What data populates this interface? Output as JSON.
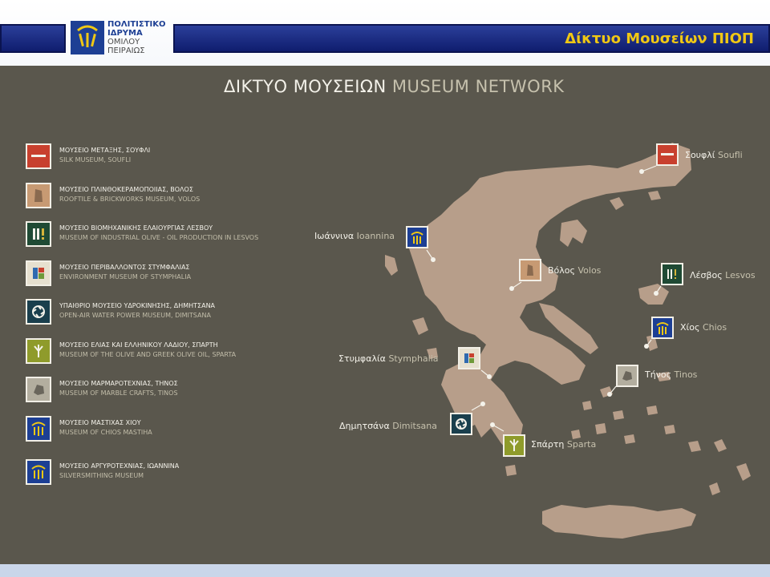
{
  "header": {
    "logo": {
      "line1": "ΠΟΛΙΤΙΣΤΙΚΟ",
      "line2": "ΙΔΡΥΜΑ",
      "line3": "ΟΜΙΛΟΥ",
      "line4": "ΠΕΙΡΑΙΩΣ"
    },
    "title": "Δίκτυο Μουσείων ΠΙΟΠ"
  },
  "panel": {
    "title_gr": "ΔΙΚΤΥΟ ΜΟΥΣΕΙΩΝ",
    "title_en": "MUSEUM NETWORK"
  },
  "legend": [
    {
      "gr": "ΜΟΥΣΕΙΟ ΜΕΤΑΞΗΣ, ΣΟΥΦΛΙ",
      "en": "SILK MUSEUM, SOUFLI",
      "color": "#c8402e",
      "icon": "silk-icon"
    },
    {
      "gr": "ΜΟΥΣΕΙΟ ΠΛΙΝΘΟΚΕΡΑΜΟΠΟΙΙΑΣ, ΒΟΛΟΣ",
      "en": "ROOFTILE & BRICKWORKS MUSEUM, VOLOS",
      "color": "#c79a73",
      "icon": "brick-icon"
    },
    {
      "gr": "ΜΟΥΣΕΙΟ ΒΙΟΜΗΧΑΝΙΚΗΣ ΕΛΑΙΟΥΡΓΙΑΣ ΛΕΣΒΟΥ",
      "en": "MUSEUM OF INDUSTRIAL OLIVE - OIL PRODUCTION IN LESVOS",
      "color": "#1f4a34",
      "icon": "olive-press-icon"
    },
    {
      "gr": "ΜΟΥΣΕΙΟ ΠΕΡΙΒΑΛΛΟΝΤΟΣ ΣΤΥΜΦΑΛΙΑΣ",
      "en": "ENVIRONMENT MUSEUM OF STYMPHALIA",
      "color": "#e6e0cf",
      "icon": "environment-icon"
    },
    {
      "gr": "ΥΠΑΙΘΡΙΟ ΜΟΥΣΕΙΟ ΥΔΡΟΚΙΝΗΣΗΣ, ΔΗΜΗΤΣΑΝΑ",
      "en": "OPEN-AIR WATER POWER MUSEUM, DIMITSANA",
      "color": "#1a3f4d",
      "icon": "water-wheel-icon"
    },
    {
      "gr": "ΜΟΥΣΕΙΟ ΕΛΙΑΣ ΚΑΙ ΕΛΛΗΝΙΚΟΥ ΛΑΔΙΟΥ, ΣΠΑΡΤΗ",
      "en": "MUSEUM OF THE OLIVE AND GREEK OLIVE OIL, SPARTA",
      "color": "#8f9b2b",
      "icon": "olive-tree-icon"
    },
    {
      "gr": "ΜΟΥΣΕΙΟ ΜΑΡΜΑΡΟΤΕΧΝΙΑΣ, ΤΗΝΟΣ",
      "en": "MUSEUM OF MARBLE CRAFTS, TINOS",
      "color": "#b3ae9f",
      "icon": "marble-icon"
    },
    {
      "gr": "ΜΟΥΣΕΙΟ ΜΑΣΤΙΧΑΣ ΧΙΟΥ",
      "en": "MUSEUM OF CHIOS MASTIHA",
      "color": "#1d3f94",
      "icon": "piop-icon"
    },
    {
      "gr": "ΜΟΥΣΕΙΟ ΑΡΓΥΡΟΤΕΧΝΙΑΣ, ΙΩΑΝΝΙΝΑ",
      "en": "SILVERSMITHING MUSEUM",
      "color": "#1d3f94",
      "icon": "piop-icon"
    }
  ],
  "map_labels": [
    {
      "gr": "Σουφλί",
      "en": "Soufli",
      "color": "#c8402e",
      "icon": "silk-icon"
    },
    {
      "gr": "Ιωάννινα",
      "en": "Ioannina",
      "color": "#1d3f94",
      "icon": "piop-icon"
    },
    {
      "gr": "Βόλος",
      "en": "Volos",
      "color": "#c79a73",
      "icon": "brick-icon"
    },
    {
      "gr": "Λέσβος",
      "en": "Lesvos",
      "color": "#1f4a34",
      "icon": "olive-press-icon"
    },
    {
      "gr": "Χίος",
      "en": "Chios",
      "color": "#1d3f94",
      "icon": "piop-icon"
    },
    {
      "gr": "Στυμφαλία",
      "en": "Stymphalia",
      "color": "#e6e0cf",
      "icon": "environment-icon"
    },
    {
      "gr": "Τήνος",
      "en": "Tinos",
      "color": "#b3ae9f",
      "icon": "marble-icon"
    },
    {
      "gr": "Δημητσάνα",
      "en": "Dimitsana",
      "color": "#1a3f4d",
      "icon": "water-wheel-icon"
    },
    {
      "gr": "Σπάρτη",
      "en": "Sparta",
      "color": "#8f9b2b",
      "icon": "olive-tree-icon"
    }
  ],
  "colors": {
    "panel": "#5a574d",
    "land": "#b79e8a",
    "header_bar": "#1a2d85",
    "title_accent": "#f0c814"
  }
}
